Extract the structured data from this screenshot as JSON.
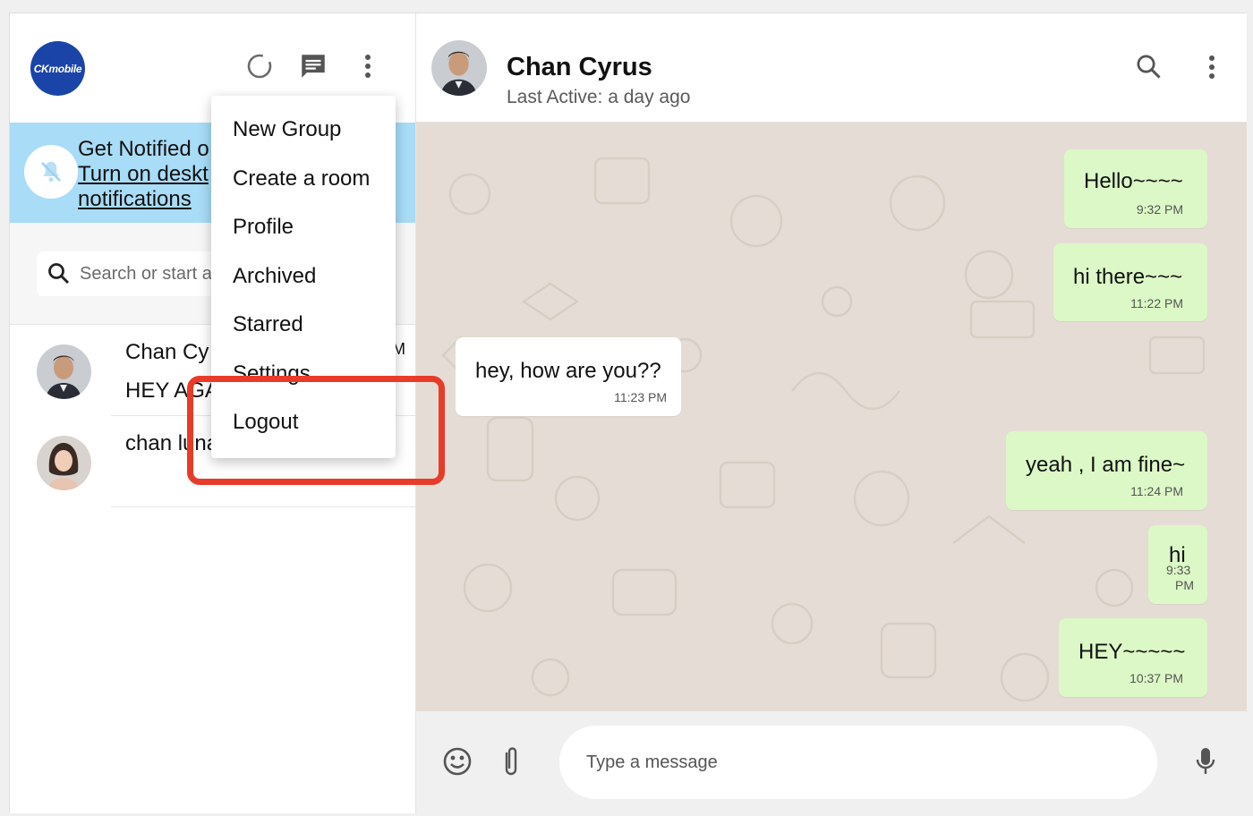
{
  "sidebar": {
    "logo_text": "CKmobile",
    "notification": {
      "title": "Get Notified o",
      "link_line1": "Turn on deskt",
      "link_line2": "notifications"
    },
    "search": {
      "placeholder": "Search or start a"
    },
    "chats": [
      {
        "name": "Chan Cy",
        "last_message": "HEY AGA",
        "time": "M"
      },
      {
        "name": "chan luna",
        "last_message": ""
      }
    ]
  },
  "menu": {
    "items": [
      "New Group",
      "Create a room",
      "Profile",
      "Archived",
      "Starred",
      "Settings",
      "Logout"
    ]
  },
  "chat": {
    "contact_name": "Chan Cyrus",
    "status": "Last Active: a day ago",
    "messages": [
      {
        "text": "Hello~~~~",
        "time": "9:32 PM",
        "direction": "out"
      },
      {
        "text": "hi there~~~",
        "time": "11:22 PM",
        "direction": "out"
      },
      {
        "text": "hey, how are you??",
        "time": "11:23 PM",
        "direction": "in"
      },
      {
        "text": "yeah , I am fine~",
        "time": "11:24 PM",
        "direction": "out"
      },
      {
        "text": "hi",
        "time": "9:33 PM",
        "time_line1": "9:33",
        "time_line2": "PM",
        "direction": "out"
      },
      {
        "text": "HEY~~~~~",
        "time": "10:37 PM",
        "direction": "out"
      }
    ],
    "input_placeholder": "Type a message"
  },
  "colors": {
    "outgoing_bubble": "#dcf8c6",
    "incoming_bubble": "#ffffff",
    "chat_background": "#e5ddd5",
    "notification_banner": "#a8dcf7",
    "highlight_box": "#e83b2a",
    "logo_bg": "#1a44a8"
  },
  "icons": [
    "status-icon",
    "chat-icon",
    "more-vert-icon",
    "bell-off-icon",
    "search-icon",
    "emoji-icon",
    "attach-icon",
    "mic-icon"
  ]
}
